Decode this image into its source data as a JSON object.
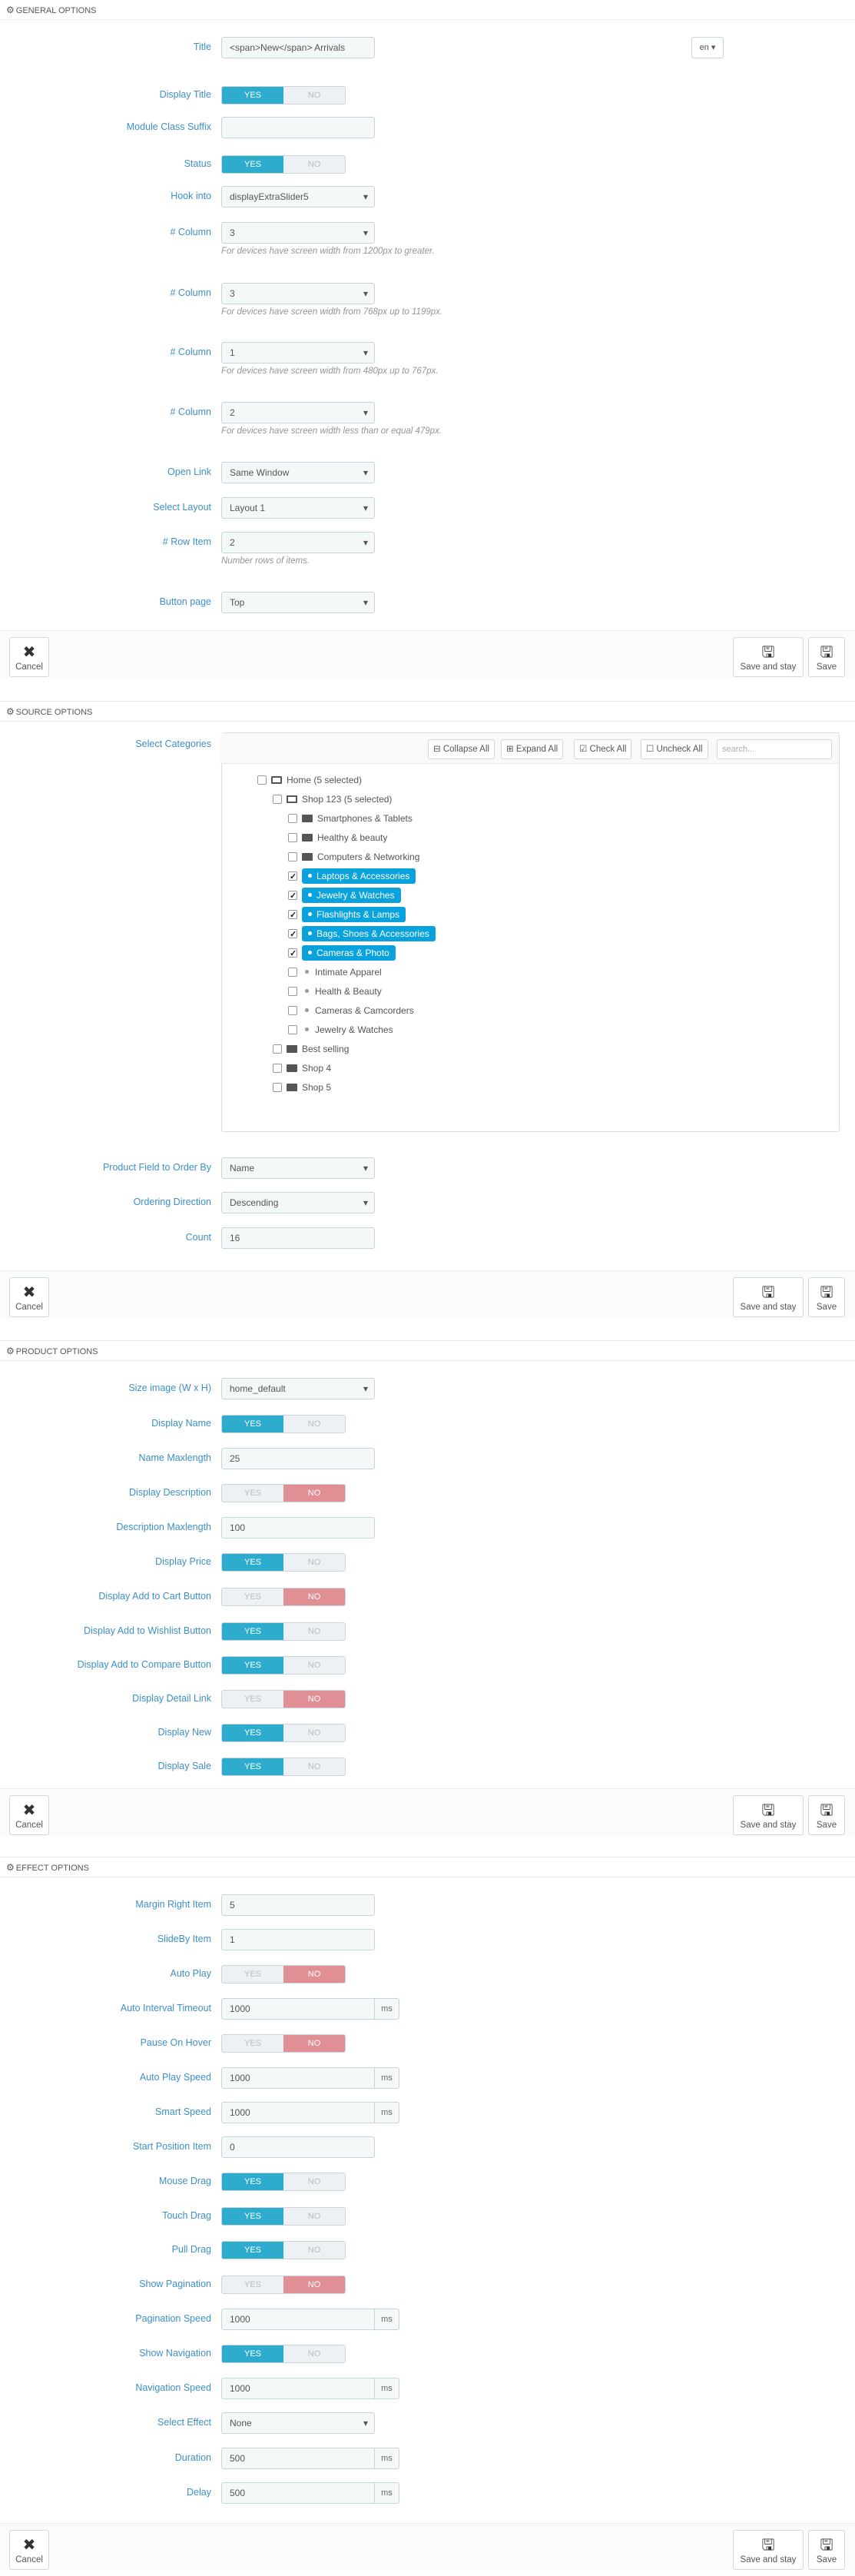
{
  "general": {
    "header": "GENERAL OPTIONS",
    "title_label": "Title",
    "title_value": "<span>New</span> Arrivals",
    "lang": "en",
    "display_title_label": "Display Title",
    "module_class_label": "Module Class Suffix",
    "module_class_value": "",
    "status_label": "Status",
    "hook_label": "Hook into",
    "hook_value": "displayExtraSlider5",
    "col_label": "# Column",
    "col1_value": "3",
    "col1_help": "For devices have screen width from 1200px to greater.",
    "col2_value": "3",
    "col2_help": "For devices have screen width from 768px up to 1199px.",
    "col3_value": "1",
    "col3_help": "For devices have screen width from 480px up to 767px.",
    "col4_value": "2",
    "col4_help": "For devices have screen width less than or equal 479px.",
    "open_link_label": "Open Link",
    "open_link_value": "Same Window",
    "layout_label": "Select Layout",
    "layout_value": "Layout 1",
    "row_item_label": "# Row Item",
    "row_item_value": "2",
    "row_item_help": "Number rows of items.",
    "button_page_label": "Button page",
    "button_page_value": "Top"
  },
  "switch": {
    "yes": "YES",
    "no": "NO"
  },
  "footer": {
    "cancel": "Cancel",
    "save_stay": "Save and stay",
    "save": "Save"
  },
  "source": {
    "header": "SOURCE OPTIONS",
    "select_categories_label": "Select Categories",
    "toolbar": {
      "collapse": "Collapse All",
      "expand": "Expand All",
      "check": "Check All",
      "uncheck": "Uncheck All",
      "search_placeholder": "search..."
    },
    "tree": {
      "home": "Home (5 selected)",
      "shop123": "Shop 123 (5 selected)",
      "c1": "Smartphones & Tablets",
      "c2": "Healthy & beauty",
      "c3": "Computers & Networking",
      "c4": "Laptops & Accessories",
      "c5": "Jewelry & Watches",
      "c6": "Flashlights & Lamps",
      "c7": "Bags, Shoes & Accessories",
      "c8": "Cameras & Photo",
      "c9": "Intimate Apparel",
      "c10": "Health & Beauty",
      "c11": "Cameras & Camcorders",
      "c12": "Jewelry & Watches",
      "best": "Best selling",
      "shop4": "Shop 4",
      "shop5": "Shop 5"
    },
    "order_by_label": "Product Field to Order By",
    "order_by_value": "Name",
    "direction_label": "Ordering Direction",
    "direction_value": "Descending",
    "count_label": "Count",
    "count_value": "16"
  },
  "product": {
    "header": "PRODUCT OPTIONS",
    "size_label": "Size image (W x H)",
    "size_value": "home_default",
    "display_name_label": "Display Name",
    "name_max_label": "Name Maxlength",
    "name_max_value": "25",
    "display_desc_label": "Display Description",
    "desc_max_label": "Description Maxlength",
    "desc_max_value": "100",
    "display_price_label": "Display Price",
    "cart_label": "Display Add to Cart Button",
    "wishlist_label": "Display Add to Wishlist Button",
    "compare_label": "Display Add to Compare Button",
    "detail_label": "Display Detail Link",
    "new_label": "Display New",
    "sale_label": "Display Sale"
  },
  "effect": {
    "header": "EFFECT OPTIONS",
    "margin_label": "Margin Right Item",
    "margin_value": "5",
    "slideby_label": "SlideBy Item",
    "slideby_value": "1",
    "autoplay_label": "Auto Play",
    "interval_label": "Auto Interval Timeout",
    "interval_value": "1000",
    "pause_label": "Pause On Hover",
    "autoplay_speed_label": "Auto Play Speed",
    "autoplay_speed_value": "1000",
    "smart_label": "Smart Speed",
    "smart_value": "1000",
    "start_label": "Start Position Item",
    "start_value": "0",
    "mouse_label": "Mouse Drag",
    "touch_label": "Touch Drag",
    "pull_label": "Pull Drag",
    "pagination_label": "Show Pagination",
    "pagination_speed_label": "Pagination Speed",
    "pagination_speed_value": "1000",
    "navigation_label": "Show Navigation",
    "navigation_speed_label": "Navigation Speed",
    "navigation_speed_value": "1000",
    "effect_label": "Select Effect",
    "effect_value": "None",
    "duration_label": "Duration",
    "duration_value": "500",
    "delay_label": "Delay",
    "delay_value": "500",
    "unit": "ms"
  },
  "colors": {
    "label": "#3d8fc6",
    "yes": "#2eacce",
    "no": "#e08f95",
    "highlight": "#09a2dc"
  }
}
